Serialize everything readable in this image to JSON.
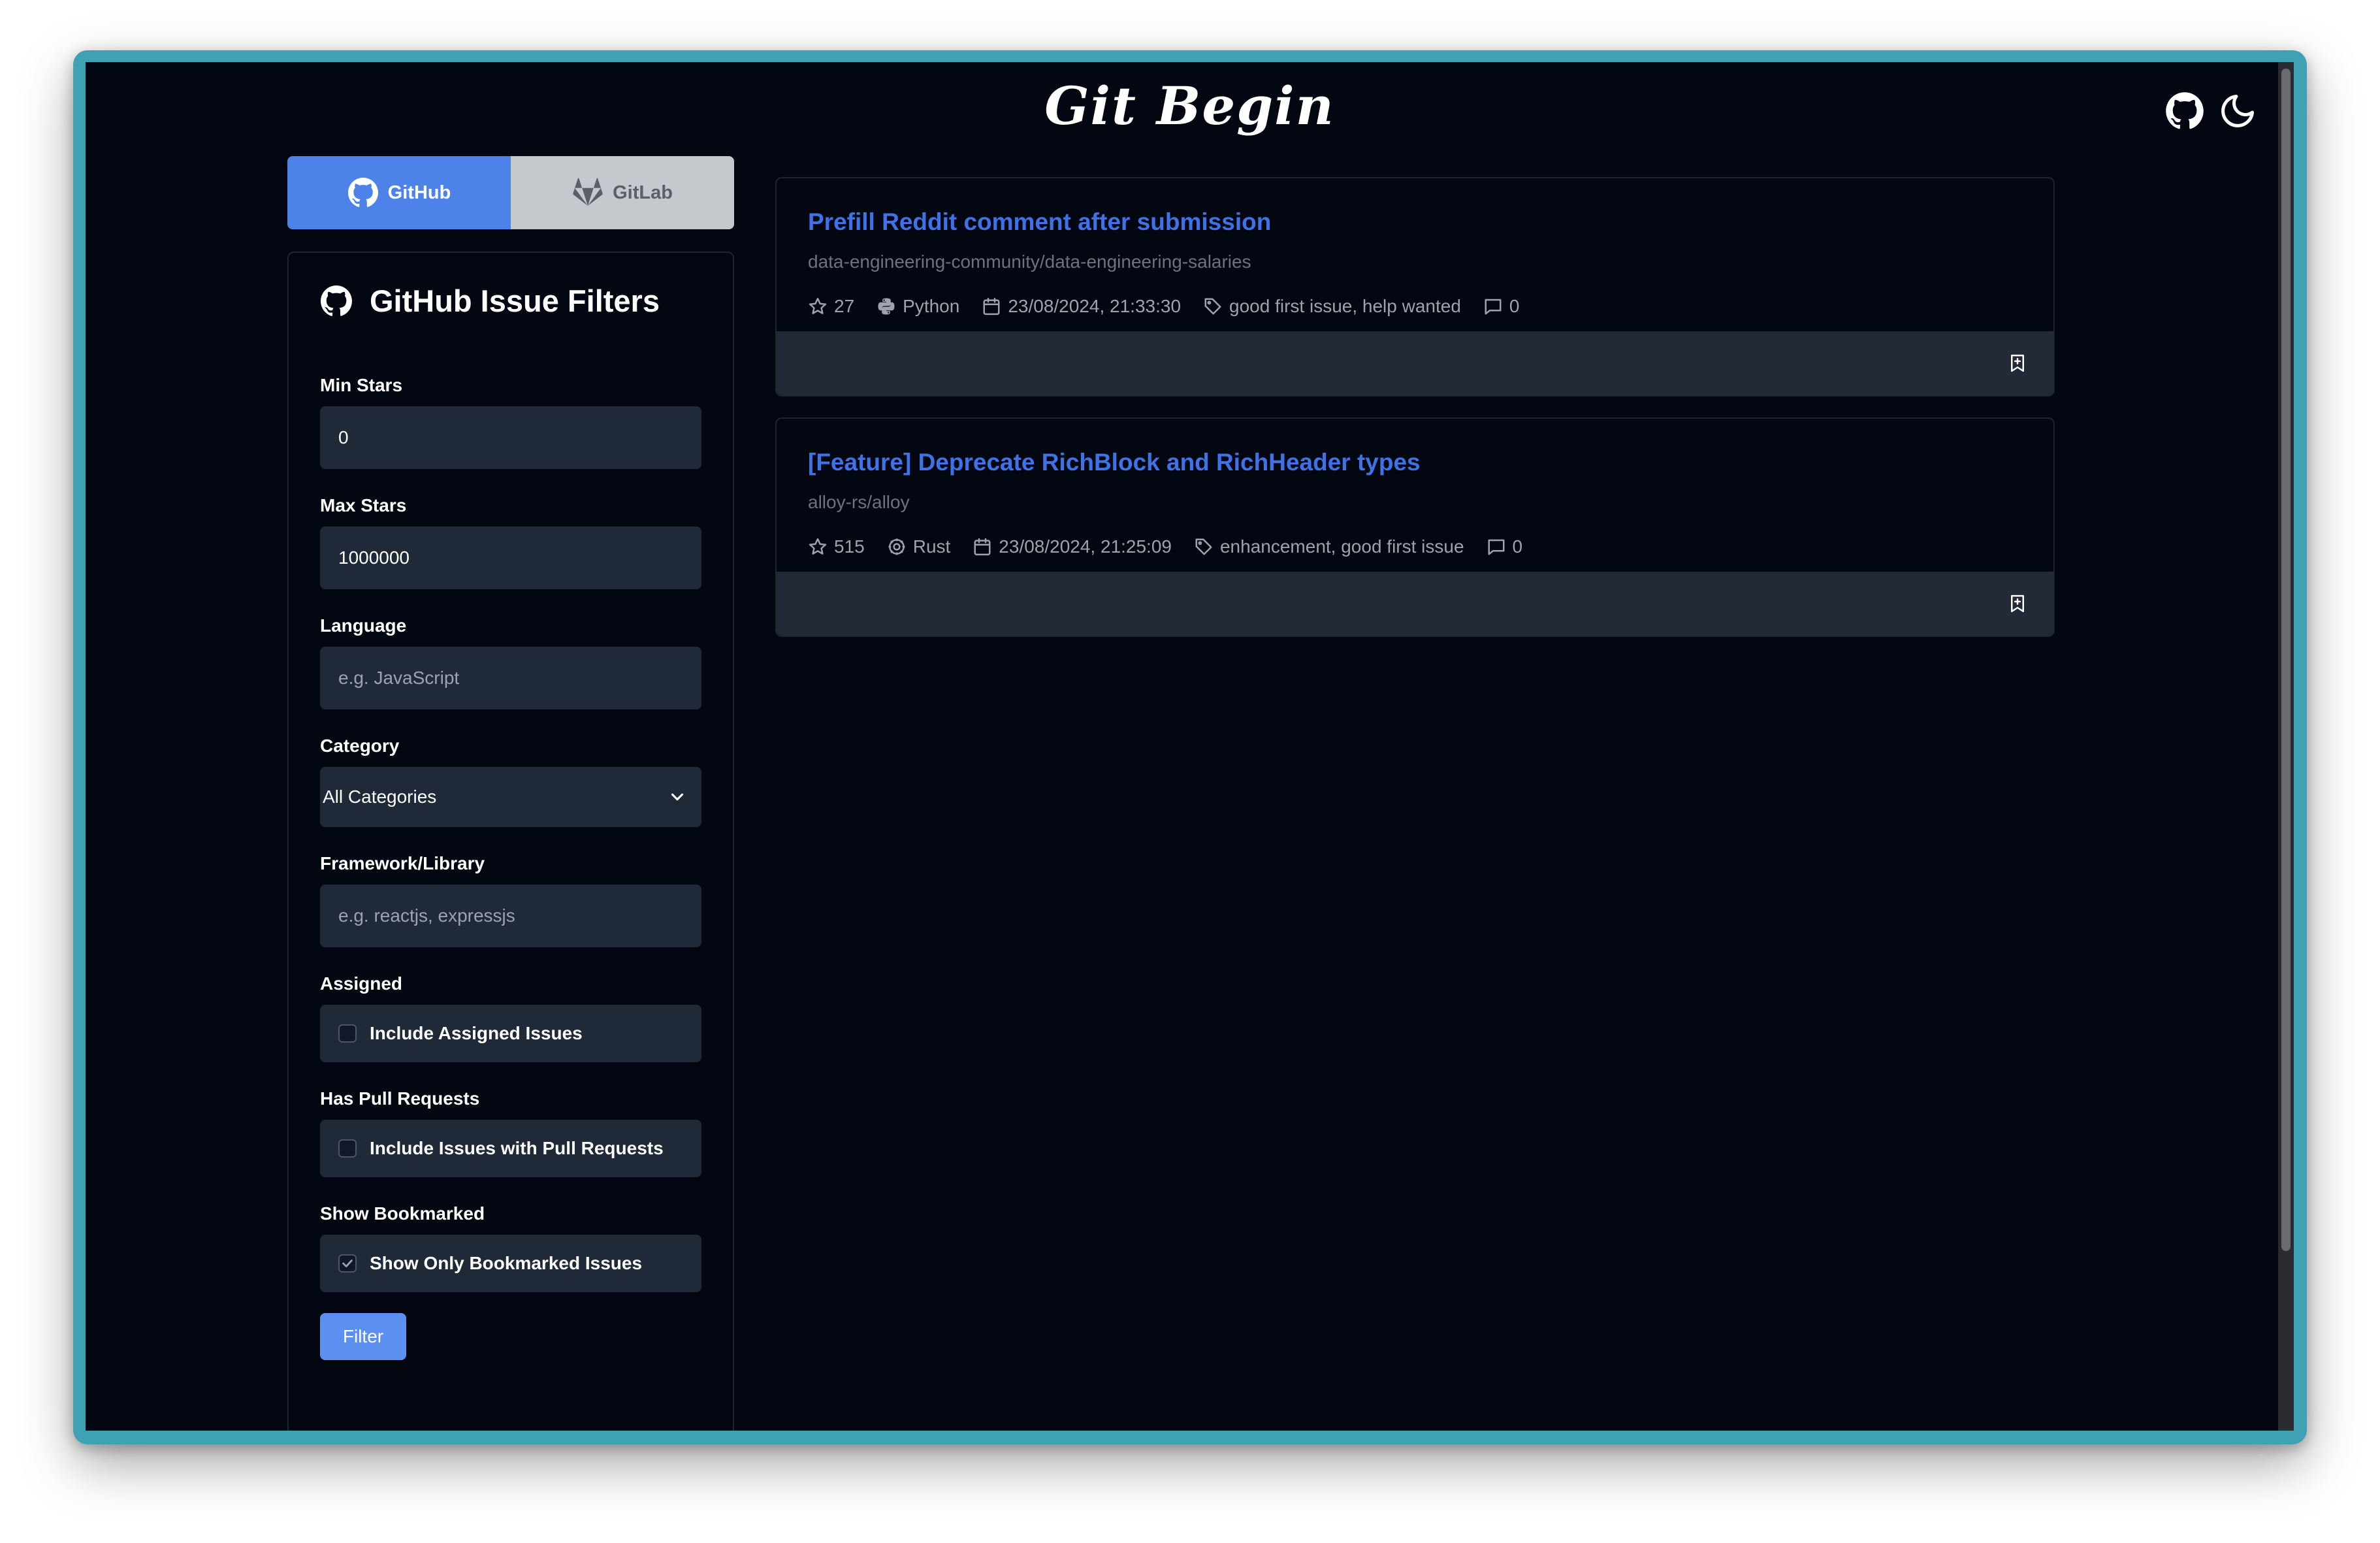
{
  "app": {
    "title": "Git Begin"
  },
  "platform_tabs": [
    {
      "label": "GitHub",
      "active": true,
      "icon": "github-icon"
    },
    {
      "label": "GitLab",
      "active": false,
      "icon": "gitlab-icon"
    }
  ],
  "filters": {
    "title": "GitHub Issue Filters",
    "min_stars": {
      "label": "Min Stars",
      "value": "0"
    },
    "max_stars": {
      "label": "Max Stars",
      "value": "1000000"
    },
    "language": {
      "label": "Language",
      "placeholder": "e.g. JavaScript"
    },
    "category": {
      "label": "Category",
      "selected": "All Categories"
    },
    "framework": {
      "label": "Framework/Library",
      "placeholder": "e.g. reactjs, expressjs"
    },
    "assigned": {
      "label": "Assigned",
      "checkbox_label": "Include Assigned Issues",
      "checked": false
    },
    "pull_requests": {
      "label": "Has Pull Requests",
      "checkbox_label": "Include Issues with Pull Requests",
      "checked": false
    },
    "bookmarked": {
      "label": "Show Bookmarked",
      "checkbox_label": "Show Only Bookmarked Issues",
      "checked": true
    },
    "submit_label": "Filter"
  },
  "issues": [
    {
      "title": "Prefill Reddit comment after submission",
      "repo": "data-engineering-community/data-engineering-salaries",
      "stars": "27",
      "language": "Python",
      "date": "23/08/2024, 21:33:30",
      "labels": "good first issue, help wanted",
      "comments": "0"
    },
    {
      "title": "[Feature] Deprecate RichBlock and RichHeader types",
      "repo": "alloy-rs/alloy",
      "stars": "515",
      "language": "Rust",
      "date": "23/08/2024, 21:25:09",
      "labels": "enhancement, good first issue",
      "comments": "0"
    }
  ],
  "colors": {
    "background": "#030712",
    "accent": "#4d83e8",
    "issue_title": "#3f72e6",
    "frame": "#3fa2b4"
  }
}
